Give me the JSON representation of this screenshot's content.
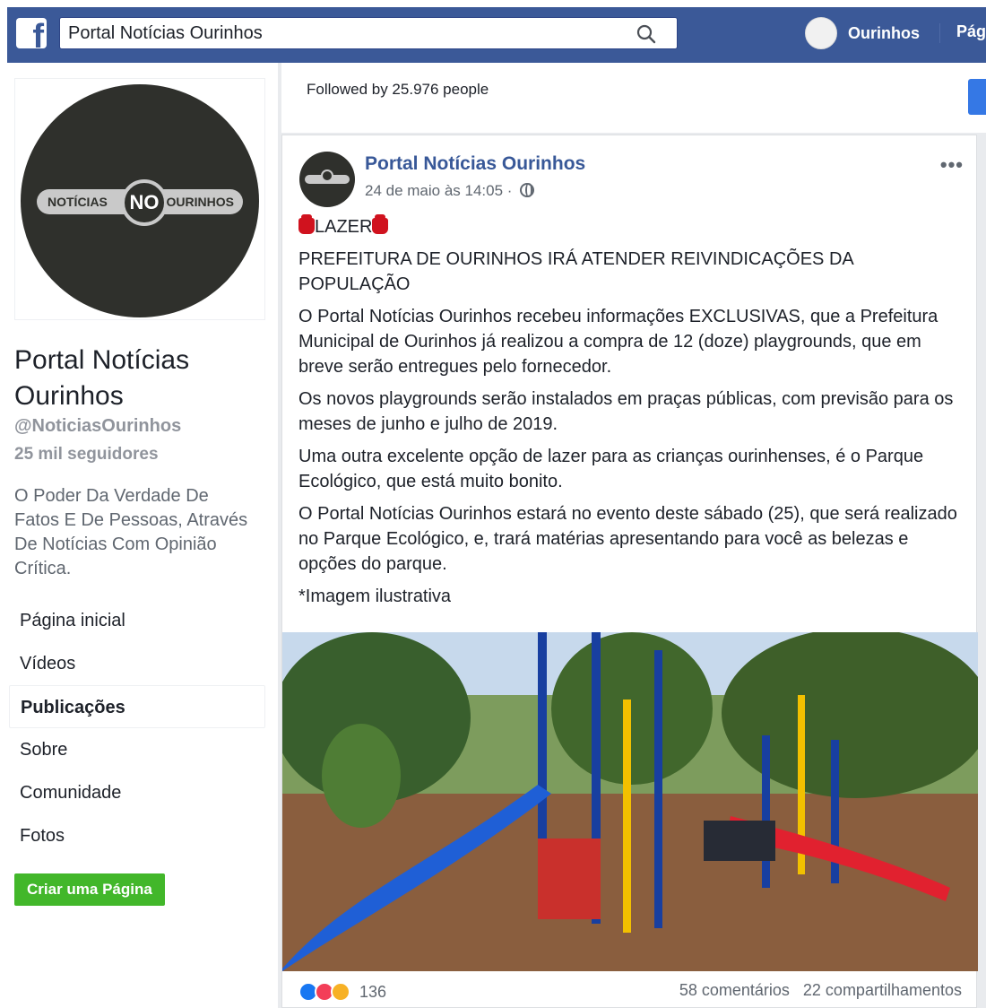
{
  "topbar": {
    "logo": "f",
    "search_value": "Portal Notícias Ourinhos",
    "profile_name": "Ourinhos",
    "pages_label": "Pág"
  },
  "left": {
    "logo_left": "NOTÍCIAS",
    "logo_no": "NO",
    "logo_right": "OURINHOS",
    "page_title": "Portal Notícias Ourinhos",
    "handle": "@NoticiasOurinhos",
    "followers": "25 mil seguidores",
    "bio": "O Poder Da Verdade De Fatos E De Pessoas, Através De Notícias Com Opinião Crítica.",
    "nav": [
      {
        "label": "Página inicial"
      },
      {
        "label": "Vídeos"
      },
      {
        "label": "Publicações",
        "active": true
      },
      {
        "label": "Sobre"
      },
      {
        "label": "Comunidade"
      },
      {
        "label": "Fotos"
      }
    ],
    "create_page": "Criar uma Página"
  },
  "followed_text": "Followed by 25.976 people",
  "post": {
    "author": "Portal Notícias Ourinhos",
    "time": "24 de maio às 14:05 ·",
    "tag": "LAZER",
    "headline": "PREFEITURA DE OURINHOS IRÁ ATENDER REIVINDICAÇÕES DA POPULAÇÃO",
    "paragraphs": [
      "O Portal Notícias Ourinhos recebeu informações EXCLUSIVAS, que a Prefeitura Municipal de Ourinhos já realizou a compra de 12 (doze) playgrounds, que em breve serão entregues pelo fornecedor.",
      "Os novos playgrounds serão instalados em praças públicas, com previsão para os meses de junho e julho de 2019.",
      "Uma outra excelente opção de lazer para as crianças ourinhenses, é o Parque Ecológico, que está muito bonito.",
      "O Portal Notícias Ourinhos estará no evento deste sábado (25), que será realizado no Parque Ecológico, e, trará matérias apresentando para você as belezas e opções do parque.",
      "*Imagem ilustrativa"
    ],
    "reaction_count": "136",
    "comments": "58 comentários",
    "shares": "22 compartilhamentos"
  },
  "colors": {
    "brand": "#3b5998",
    "link": "#385898",
    "green": "#42b72a"
  }
}
